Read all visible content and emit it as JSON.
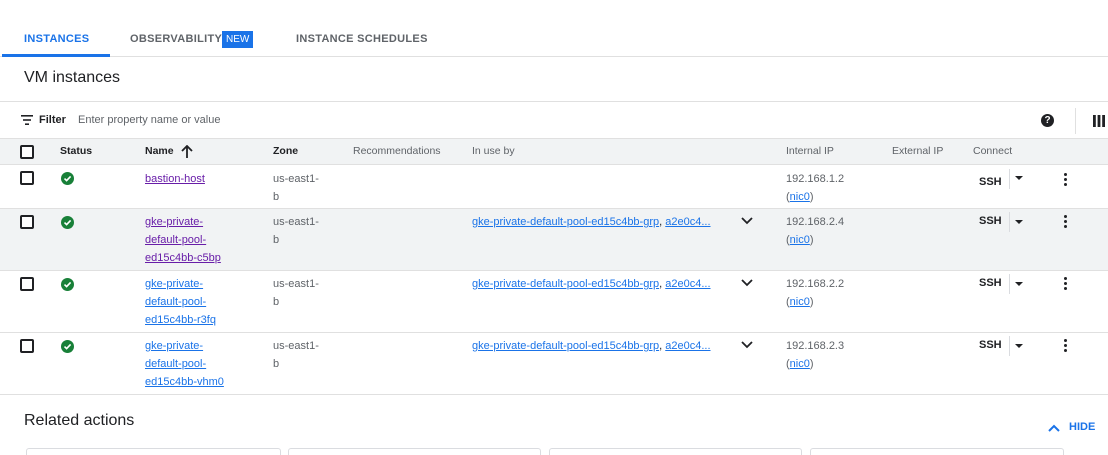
{
  "tabs": [
    {
      "label": "INSTANCES",
      "active": true
    },
    {
      "label": "OBSERVABILITY",
      "badge": "NEW"
    },
    {
      "label": "INSTANCE SCHEDULES"
    }
  ],
  "page_title": "VM instances",
  "filter": {
    "label": "Filter",
    "placeholder": "Enter property name or value"
  },
  "table": {
    "headers": {
      "status": "Status",
      "name": "Name",
      "zone": "Zone",
      "recommendations": "Recommendations",
      "in_use_by": "In use by",
      "internal_ip": "Internal IP",
      "external_ip": "External IP",
      "connect": "Connect"
    },
    "rows": [
      {
        "name_lines": [
          "bastion-host"
        ],
        "zone_lines": [
          "us-east1-",
          "b"
        ],
        "in_use_by": "",
        "in_use_by_2": "",
        "internal_ip": "192.168.1.2",
        "nic": "nic0",
        "connect": "SSH"
      },
      {
        "name_lines": [
          "gke-private-",
          "default-pool-",
          "ed15c4bb-c5bp"
        ],
        "zone_lines": [
          "us-east1-",
          "b"
        ],
        "in_use_by": "gke-private-default-pool-ed15c4bb-grp",
        "in_use_by_2": "a2e0c4...",
        "internal_ip": "192.168.2.4",
        "nic": "nic0",
        "connect": "SSH"
      },
      {
        "name_lines": [
          "gke-private-",
          "default-pool-",
          "ed15c4bb-r3fq"
        ],
        "zone_lines": [
          "us-east1-",
          "b"
        ],
        "in_use_by": "gke-private-default-pool-ed15c4bb-grp",
        "in_use_by_2": "a2e0c4...",
        "internal_ip": "192.168.2.2",
        "nic": "nic0",
        "connect": "SSH"
      },
      {
        "name_lines": [
          "gke-private-",
          "default-pool-",
          "ed15c4bb-vhm0"
        ],
        "zone_lines": [
          "us-east1-",
          "b"
        ],
        "in_use_by": "gke-private-default-pool-ed15c4bb-grp",
        "in_use_by_2": "a2e0c4...",
        "internal_ip": "192.168.2.3",
        "nic": "nic0",
        "connect": "SSH"
      }
    ]
  },
  "related": {
    "title": "Related actions",
    "hide_label": "HIDE"
  },
  "icons": {
    "filter": "filter-icon",
    "help": "help-icon",
    "columns": "columns-icon",
    "status_running": "check-circle-icon",
    "sort": "arrow-up-icon",
    "expand": "chevron-down-icon",
    "more": "more-vert-icon",
    "hide": "chevron-up-icon"
  },
  "colors": {
    "accent": "#1a73e8",
    "status_ok": "#188038",
    "visited_link": "#681da8"
  }
}
